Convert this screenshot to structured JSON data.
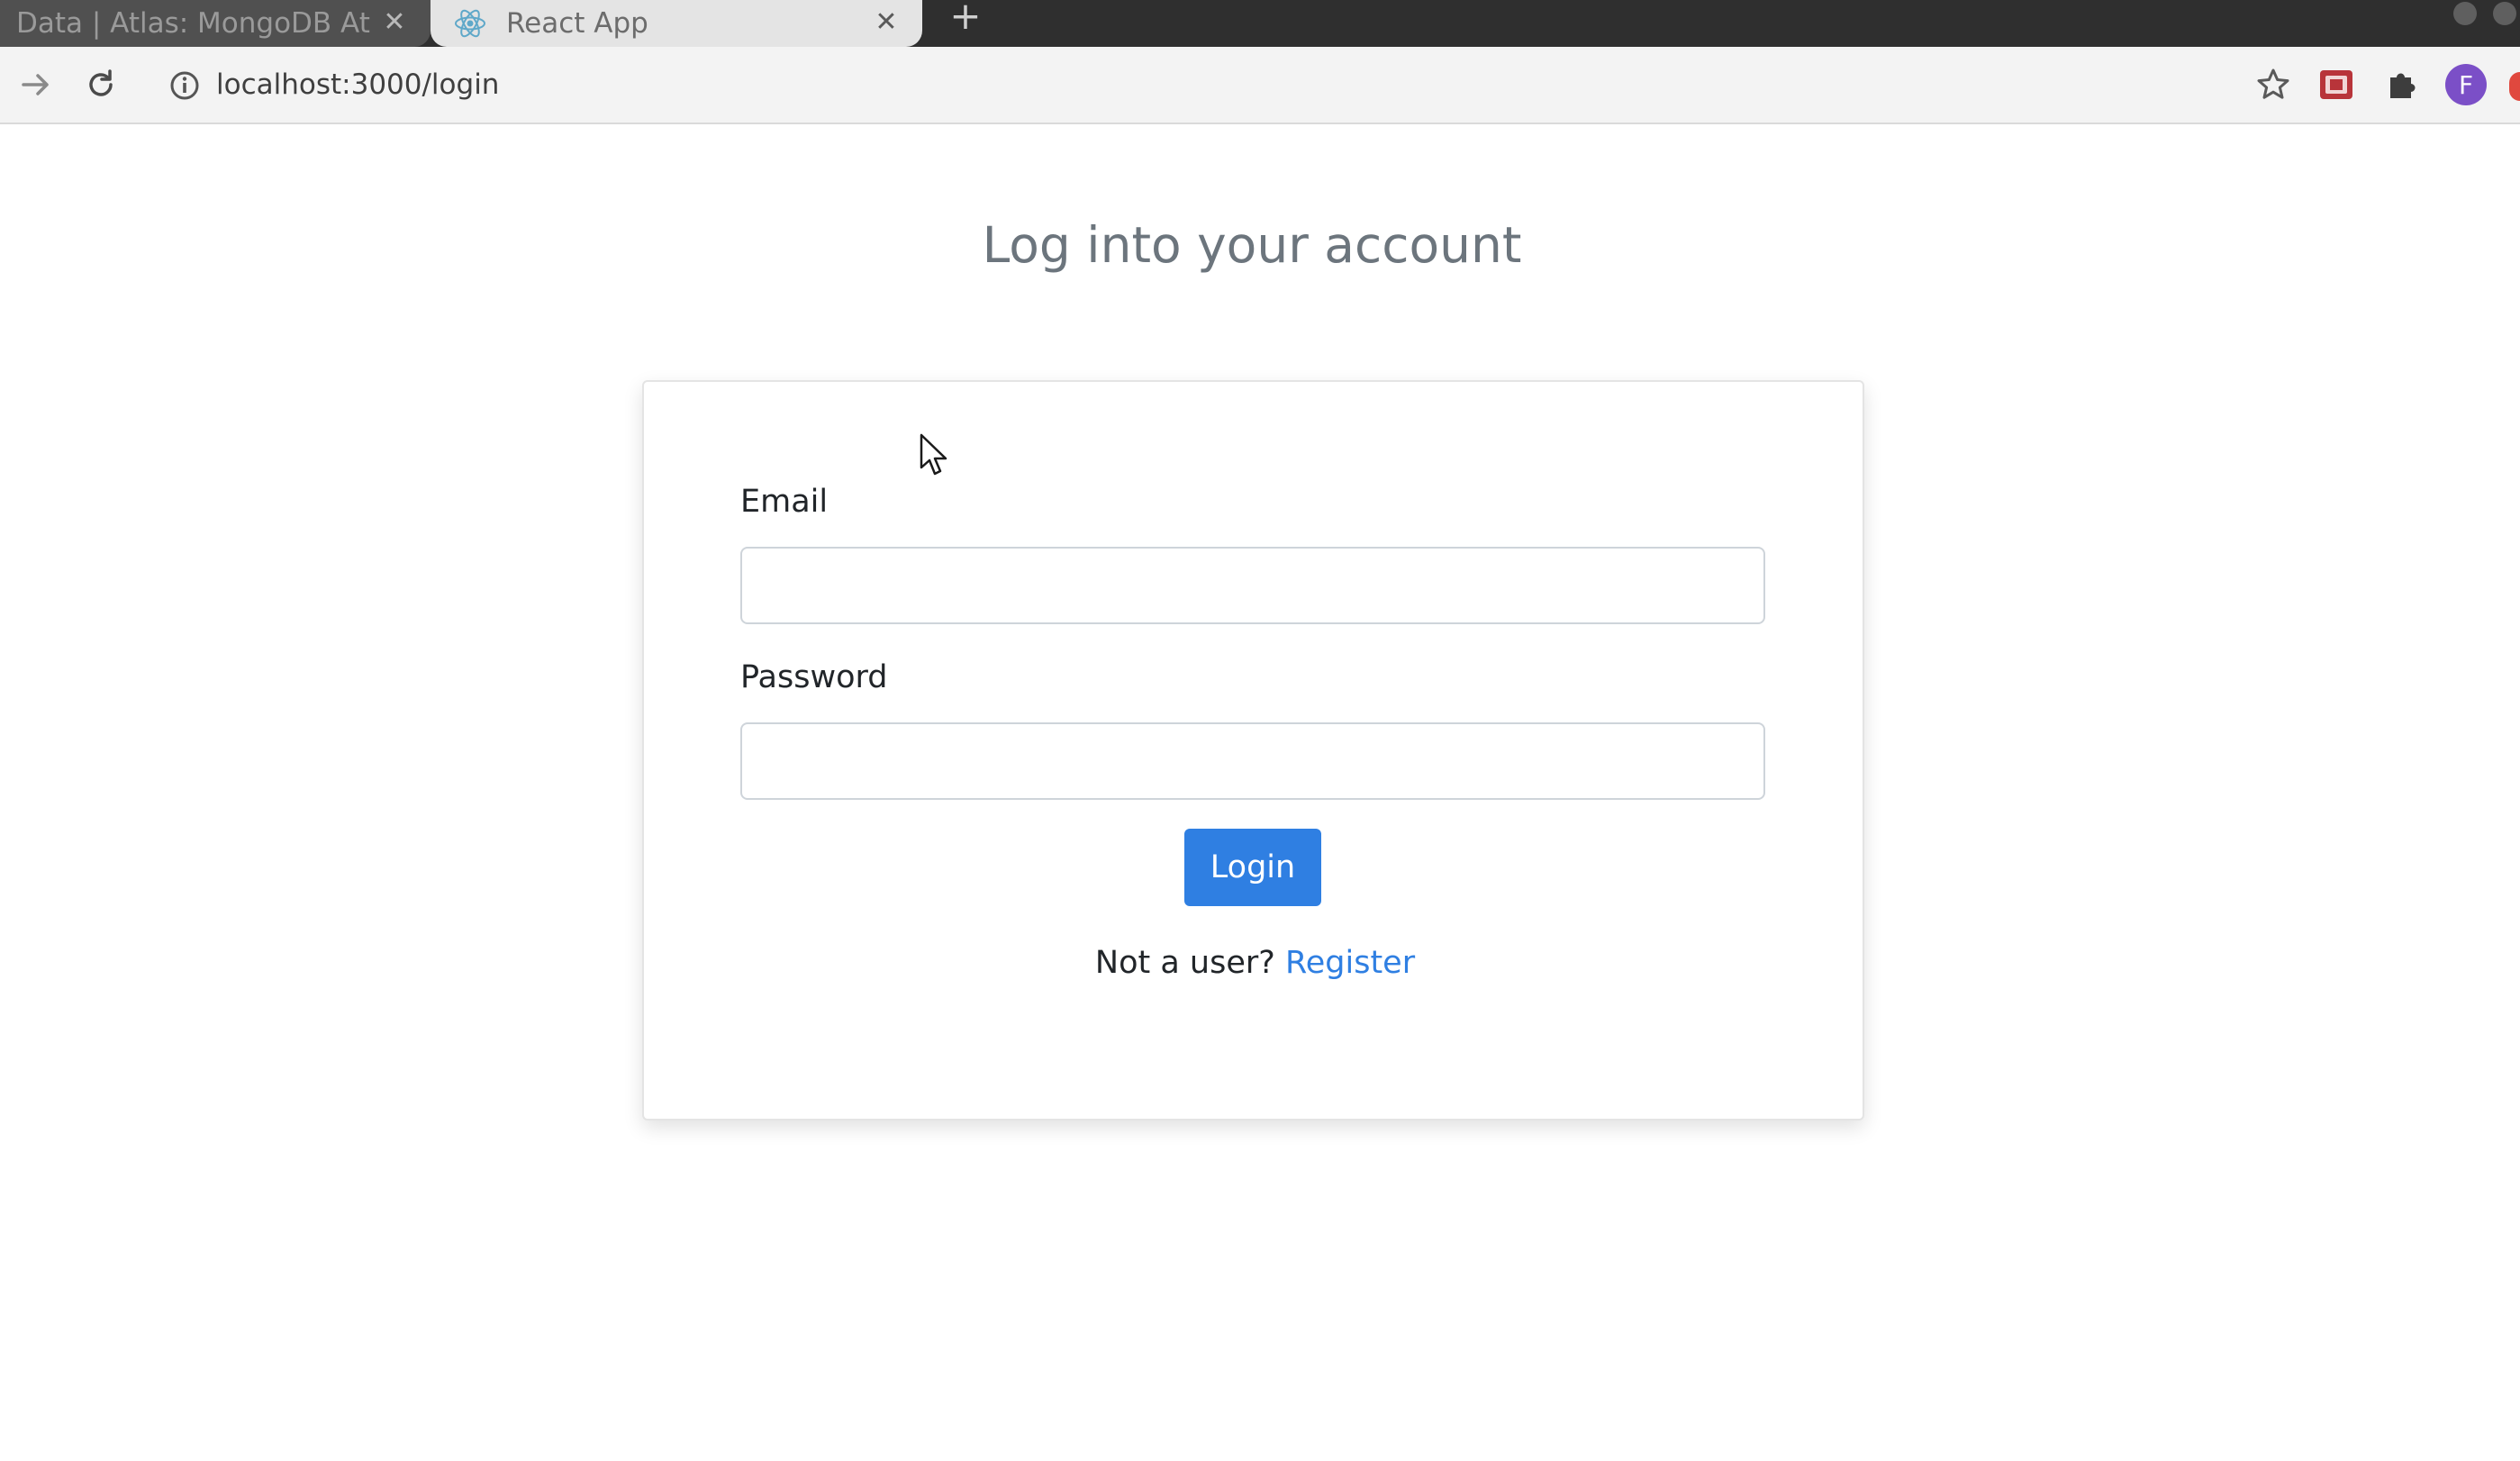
{
  "browser": {
    "tabs": [
      {
        "title": "Data | Atlas: MongoDB At",
        "active": false
      },
      {
        "title": "React App",
        "active": true
      }
    ],
    "url": "localhost:3000/login",
    "colors": {
      "tabbar": "#2f2f2f",
      "active_tab": "#e4e4e4",
      "profile_avatar": "#7b4fc7"
    },
    "profile_initial": "F"
  },
  "page": {
    "heading": "Log into your account",
    "form": {
      "email_label": "Email",
      "email_value": "",
      "password_label": "Password",
      "password_value": "",
      "login_label": "Login",
      "register_prompt": "Not a user?",
      "register_link": "Register"
    },
    "colors": {
      "primary": "#2f7fe2",
      "heading": "#6c757d",
      "text": "#212529"
    }
  }
}
